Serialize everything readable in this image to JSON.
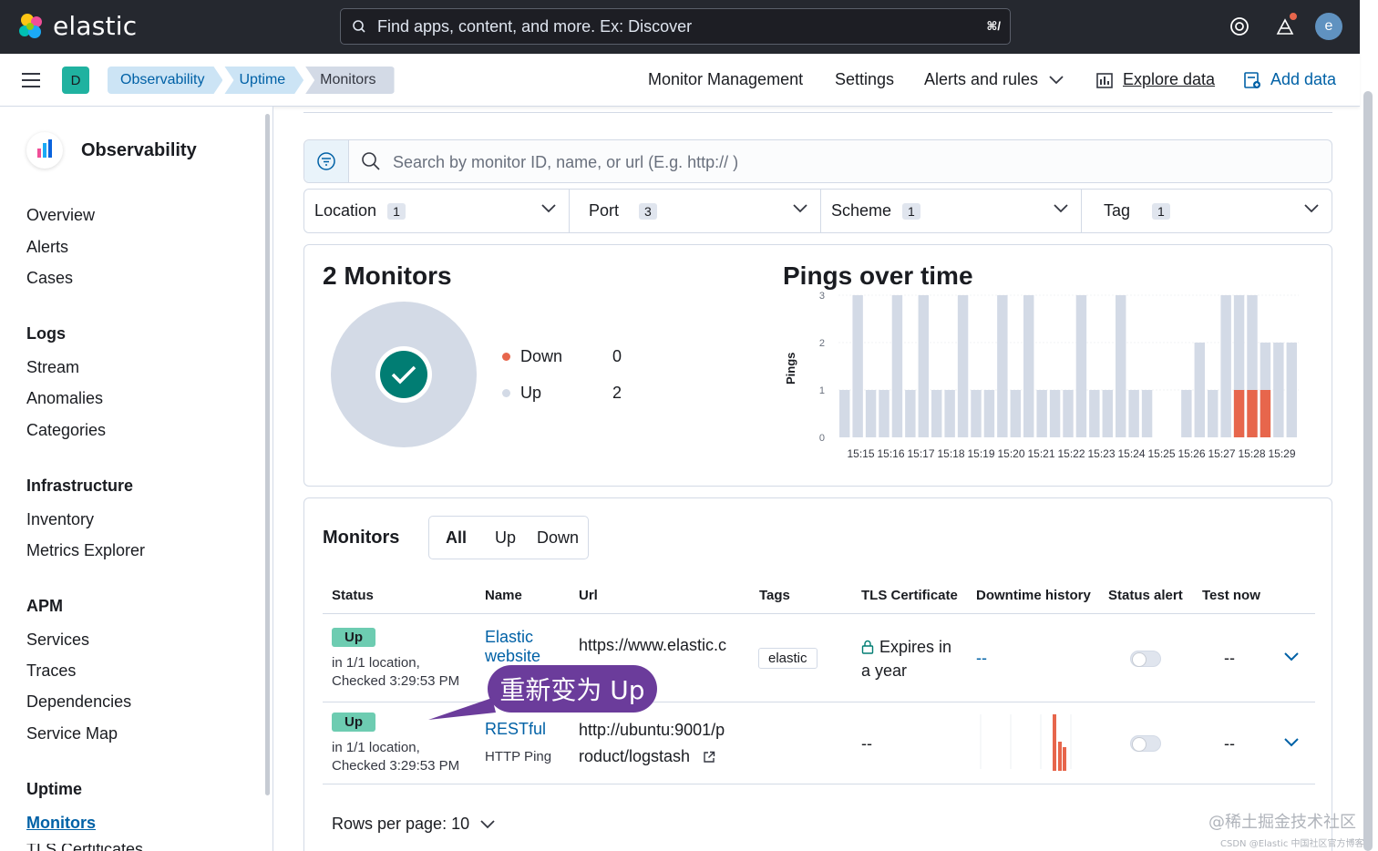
{
  "app": {
    "brand": "elastic",
    "avatar_initial": "e",
    "space_initial": "D"
  },
  "search": {
    "placeholder": "Find apps, content, and more. Ex: Discover",
    "shortcut": "⌘/"
  },
  "breadcrumbs": [
    "Observability",
    "Uptime",
    "Monitors"
  ],
  "toplinks": {
    "monitor_management": "Monitor Management",
    "settings": "Settings",
    "alerts": "Alerts and rules",
    "explore": "Explore data",
    "add_data": "Add data"
  },
  "sidebar": {
    "title": "Observability",
    "items": [
      "Overview",
      "Alerts",
      "Cases"
    ],
    "logs": {
      "heading": "Logs",
      "items": [
        "Stream",
        "Anomalies",
        "Categories"
      ]
    },
    "infra": {
      "heading": "Infrastructure",
      "items": [
        "Inventory",
        "Metrics Explorer"
      ]
    },
    "apm": {
      "heading": "APM",
      "items": [
        "Services",
        "Traces",
        "Dependencies",
        "Service Map"
      ]
    },
    "uptime": {
      "heading": "Uptime",
      "items": [
        "Monitors",
        "TLS Certificates"
      ]
    }
  },
  "main": {
    "search_placeholder": "Search by monitor ID, name, or url (E.g. http:// )",
    "filters": [
      {
        "label": "Location",
        "count": "1"
      },
      {
        "label": "Port",
        "count": "3"
      },
      {
        "label": "Scheme",
        "count": "1"
      },
      {
        "label": "Tag",
        "count": "1"
      }
    ],
    "summary": {
      "title": "2 Monitors",
      "down_label": "Down",
      "down_value": "0",
      "up_label": "Up",
      "up_value": "2"
    },
    "pings_title": "Pings over time",
    "monitors_title": "Monitors",
    "tabs": [
      "All",
      "Up",
      "Down"
    ],
    "columns": [
      "Status",
      "Name",
      "Url",
      "Tags",
      "TLS Certificate",
      "Downtime history",
      "Status alert",
      "Test now"
    ],
    "rows": [
      {
        "status": "Up",
        "location": "in 1/1 location,",
        "checked": "Checked 3:29:53 PM",
        "name": "Elastic website",
        "url": "https://www.elastic.c",
        "tag": "elastic",
        "tls1": "Expires in",
        "tls2": "a year",
        "downtime": "--",
        "test": "--"
      },
      {
        "status": "Up",
        "location": "in 1/1 location,",
        "checked": "Checked 3:29:53 PM",
        "name": "RESTful",
        "type": "HTTP Ping",
        "url1": "http://ubuntu:9001/p",
        "url2": "roduct/logstash",
        "tls": "--",
        "test": "--"
      }
    ],
    "rows_per_page": "Rows per page: 10"
  },
  "callout": "重新变为 Up",
  "watermark": {
    "line1": "@稀土掘金技术社区",
    "line2": "CSDN @Elastic 中国社区官方博客"
  },
  "colors": {
    "up": "#d3dae6",
    "down": "#e7664c",
    "accent": "#0061a6"
  },
  "chart_data": {
    "type": "bar",
    "title": "Pings over time",
    "ylabel": "Pings",
    "ylim": [
      0,
      3
    ],
    "yticks": [
      "0",
      "1",
      "2",
      "3"
    ],
    "tick_labels": [
      "15:15",
      "15:16",
      "15:17",
      "15:18",
      "15:19",
      "15:20",
      "15:21",
      "15:22",
      "15:23",
      "15:24",
      "15:25",
      "15:26",
      "15:27",
      "15:28",
      "15:29"
    ],
    "series": [
      {
        "name": "Up",
        "values": [
          1,
          3,
          1,
          1,
          3,
          1,
          3,
          1,
          1,
          3,
          1,
          1,
          3,
          1,
          3,
          1,
          1,
          1,
          3,
          1,
          1,
          3,
          1,
          1,
          0,
          0,
          1,
          2,
          1,
          3,
          3,
          3,
          2,
          2,
          2
        ]
      },
      {
        "name": "Down",
        "values": [
          0,
          0,
          0,
          0,
          0,
          0,
          0,
          0,
          0,
          0,
          0,
          0,
          0,
          0,
          0,
          0,
          0,
          0,
          0,
          0,
          0,
          0,
          0,
          0,
          0,
          0,
          0,
          0,
          0,
          0,
          1,
          1,
          1,
          0,
          0
        ]
      }
    ]
  }
}
